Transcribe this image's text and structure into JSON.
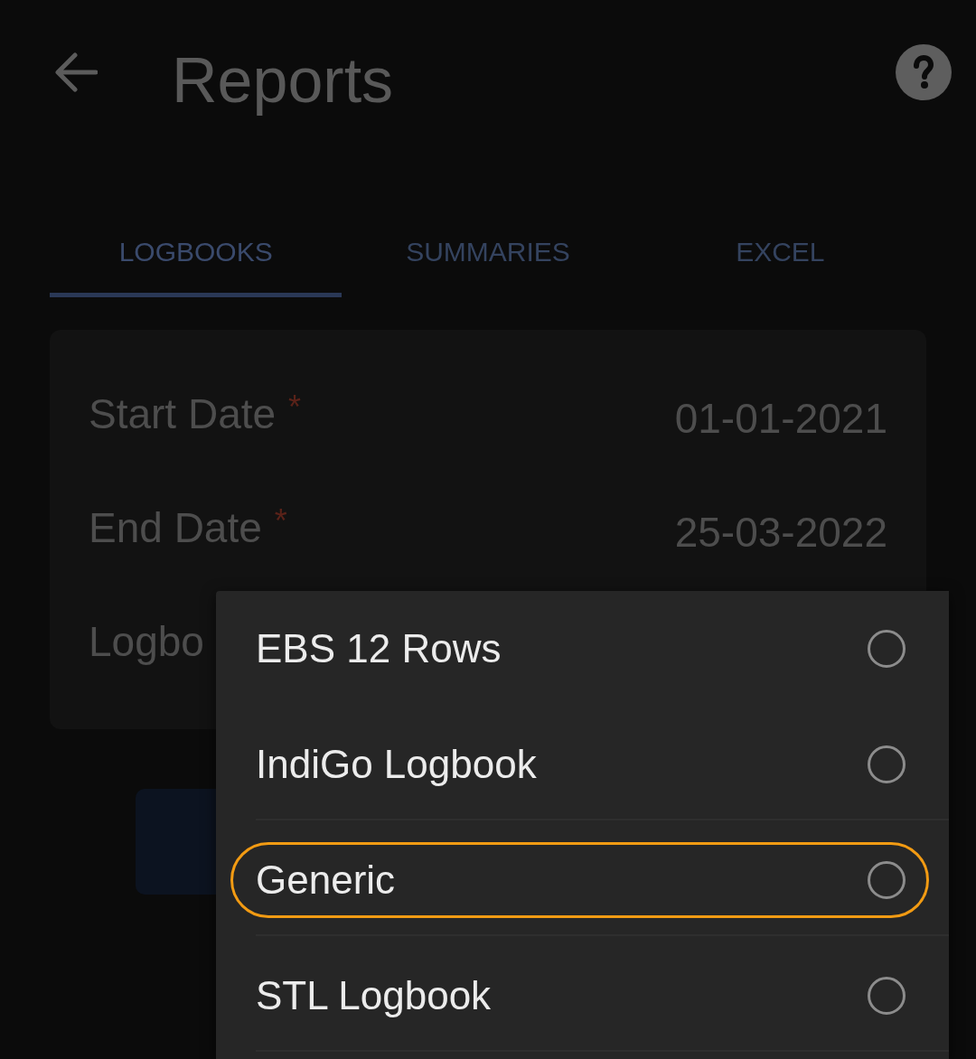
{
  "header": {
    "title": "Reports"
  },
  "tabs": [
    {
      "label": "LOGBOOKS",
      "selected": true
    },
    {
      "label": "SUMMARIES",
      "selected": false
    },
    {
      "label": "EXCEL",
      "selected": false
    }
  ],
  "form": {
    "fields": [
      {
        "label": "Start Date",
        "required_mark": "*",
        "value": "01-01-2021"
      },
      {
        "label": "End Date",
        "required_mark": "*",
        "value": "25-03-2022"
      },
      {
        "label": "Logbo"
      }
    ]
  },
  "dropdown": {
    "options": [
      {
        "label": "EBS 12 Rows",
        "selected": false,
        "focused": false
      },
      {
        "label": "IndiGo Logbook",
        "selected": false,
        "focused": false
      },
      {
        "label": "Generic",
        "selected": false,
        "focused": true
      },
      {
        "label": "STL Logbook",
        "selected": false,
        "focused": false
      }
    ]
  }
}
